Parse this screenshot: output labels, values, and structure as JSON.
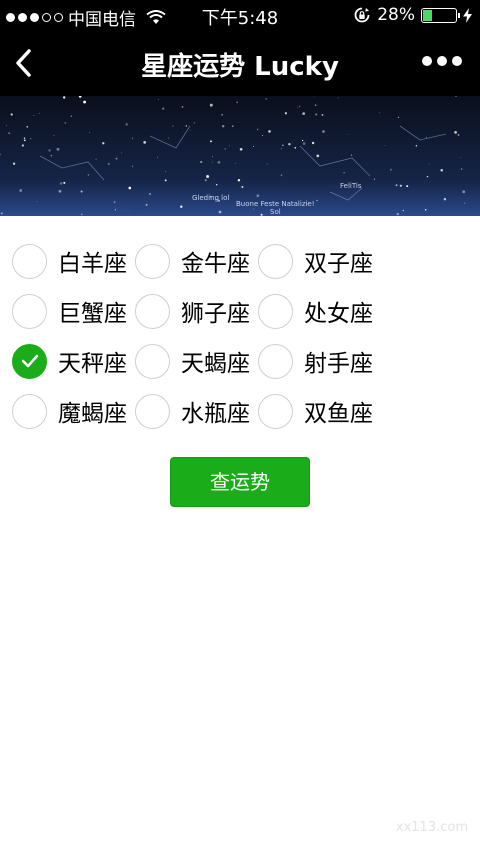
{
  "status_bar": {
    "carrier": "中国电信",
    "time": "下午5:48",
    "battery": "28%",
    "battery_level": 0.28
  },
  "nav": {
    "title": "星座运势 Lucky"
  },
  "banner": {
    "star_labels": [
      "Gleding lol",
      "Buone Feste Natalizie!",
      "Sol",
      "FeliTis"
    ]
  },
  "options": [
    [
      {
        "label": "白羊座",
        "checked": false
      },
      {
        "label": "金牛座",
        "checked": false
      },
      {
        "label": "双子座",
        "checked": false
      }
    ],
    [
      {
        "label": "巨蟹座",
        "checked": false
      },
      {
        "label": "狮子座",
        "checked": false
      },
      {
        "label": "处女座",
        "checked": false
      }
    ],
    [
      {
        "label": "天秤座",
        "checked": true
      },
      {
        "label": "天蝎座",
        "checked": false
      },
      {
        "label": "射手座",
        "checked": false
      }
    ],
    [
      {
        "label": "魔蝎座",
        "checked": false
      },
      {
        "label": "水瓶座",
        "checked": false
      },
      {
        "label": "双鱼座",
        "checked": false
      }
    ]
  ],
  "submit_label": "查运势",
  "watermark": "xx113.com",
  "colors": {
    "accent": "#1aad19",
    "nav_bg": "#000000"
  }
}
